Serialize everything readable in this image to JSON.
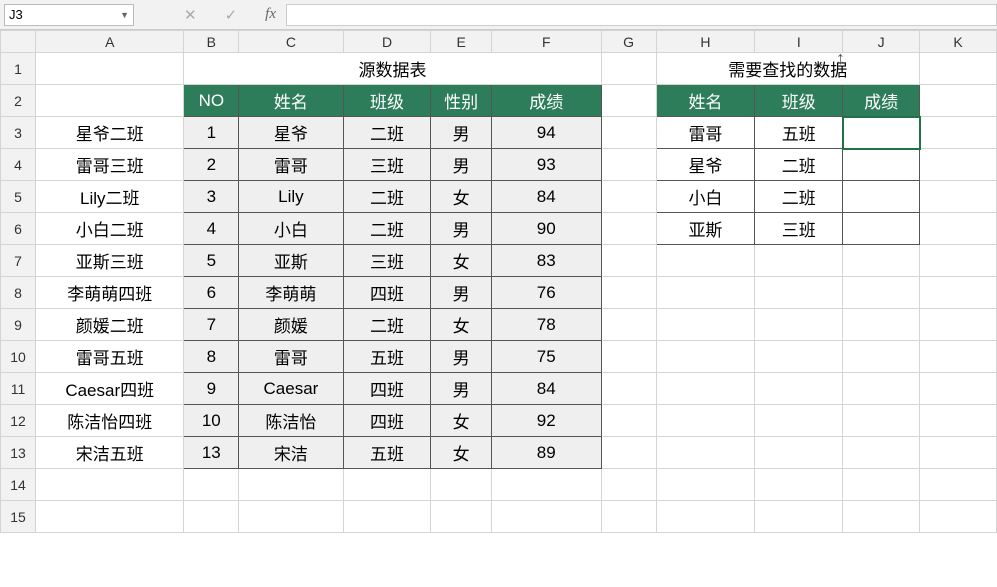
{
  "nameBox": "J3",
  "formula": "",
  "colHeaders": [
    "A",
    "B",
    "C",
    "D",
    "E",
    "F",
    "G",
    "H",
    "I",
    "J",
    "K"
  ],
  "rowHeaders": [
    "1",
    "2",
    "3",
    "4",
    "5",
    "6",
    "7",
    "8",
    "9",
    "10",
    "11",
    "12",
    "13",
    "14",
    "15"
  ],
  "titles": {
    "source": "源数据表",
    "lookup": "需要查找的数据"
  },
  "sourceHeaders": {
    "no": "NO",
    "name": "姓名",
    "class": "班级",
    "gender": "性别",
    "score": "成绩"
  },
  "lookupHeaders": {
    "name": "姓名",
    "class": "班级",
    "score": "成绩"
  },
  "sourceRows": [
    {
      "a": "星爷二班",
      "no": "1",
      "name": "星爷",
      "class": "二班",
      "gender": "男",
      "score": "94"
    },
    {
      "a": "雷哥三班",
      "no": "2",
      "name": "雷哥",
      "class": "三班",
      "gender": "男",
      "score": "93"
    },
    {
      "a": "Lily二班",
      "no": "3",
      "name": "Lily",
      "class": "二班",
      "gender": "女",
      "score": "84"
    },
    {
      "a": "小白二班",
      "no": "4",
      "name": "小白",
      "class": "二班",
      "gender": "男",
      "score": "90"
    },
    {
      "a": "亚斯三班",
      "no": "5",
      "name": "亚斯",
      "class": "三班",
      "gender": "女",
      "score": "83"
    },
    {
      "a": "李萌萌四班",
      "no": "6",
      "name": "李萌萌",
      "class": "四班",
      "gender": "男",
      "score": "76"
    },
    {
      "a": "颜媛二班",
      "no": "7",
      "name": "颜媛",
      "class": "二班",
      "gender": "女",
      "score": "78"
    },
    {
      "a": "雷哥五班",
      "no": "8",
      "name": "雷哥",
      "class": "五班",
      "gender": "男",
      "score": "75"
    },
    {
      "a": "Caesar四班",
      "no": "9",
      "name": "Caesar",
      "class": "四班",
      "gender": "男",
      "score": "84"
    },
    {
      "a": "陈洁怡四班",
      "no": "10",
      "name": "陈洁怡",
      "class": "四班",
      "gender": "女",
      "score": "92"
    },
    {
      "a": "宋洁五班",
      "no": "13",
      "name": "宋洁",
      "class": "五班",
      "gender": "女",
      "score": "89"
    }
  ],
  "lookupRows": [
    {
      "name": "雷哥",
      "class": "五班",
      "score": ""
    },
    {
      "name": "星爷",
      "class": "二班",
      "score": ""
    },
    {
      "name": "小白",
      "class": "二班",
      "score": ""
    },
    {
      "name": "亚斯",
      "class": "三班",
      "score": ""
    }
  ]
}
